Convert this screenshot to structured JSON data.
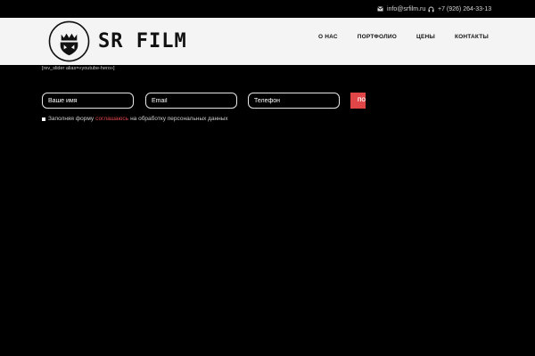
{
  "topbar": {
    "email": "info@srfilm.ru",
    "email_icon": "envelope-icon",
    "phone": "+7 (926) 264-33-13",
    "phone_icon": "headset-icon"
  },
  "header": {
    "logo_text": "SR FILM",
    "logo_icon": "crown-shield-icon",
    "nav": [
      {
        "label": "О НАС"
      },
      {
        "label": "ПОРТФОЛИО"
      },
      {
        "label": "ЦЕНЫ"
      },
      {
        "label": "КОНТАКТЫ"
      }
    ]
  },
  "shortcode_text": "[rev_slider alias=«youtube-hero»]",
  "form": {
    "name_placeholder": "Ваше имя",
    "email_placeholder": "Email",
    "phone_placeholder": "Телефон",
    "submit_label": "ПО"
  },
  "consent": {
    "before": "Заполняя форму",
    "link": "соглашаюсь",
    "after": "на обработку персональных данных"
  },
  "colors": {
    "background": "#000000",
    "header_bg": "#f4f4f4",
    "accent": "#e04548"
  }
}
